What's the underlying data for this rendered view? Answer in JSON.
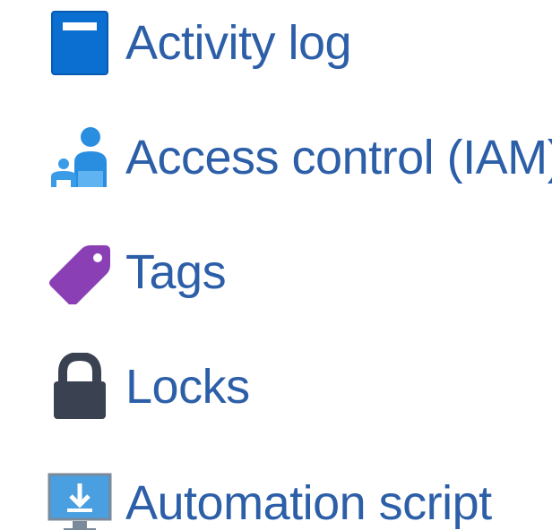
{
  "menu": {
    "items": [
      {
        "label": "Activity log",
        "icon": "activity-log-icon",
        "icon_color": "#0a6fd1"
      },
      {
        "label": "Access control (IAM)",
        "icon": "people-icon",
        "icon_color": "#2a8ee0"
      },
      {
        "label": "Tags",
        "icon": "tag-icon",
        "icon_color": "#8b3fb5"
      },
      {
        "label": "Locks",
        "icon": "lock-icon",
        "icon_color": "#3a4252"
      },
      {
        "label": "Automation script",
        "icon": "monitor-download-icon",
        "icon_color": "#4a9fe0"
      }
    ],
    "label_color": "#2c5fa8"
  }
}
